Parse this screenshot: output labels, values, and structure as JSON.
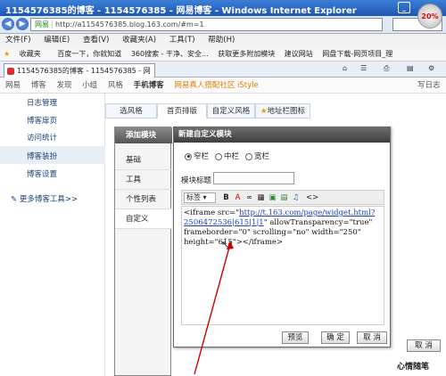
{
  "window": {
    "title": "1154576385的博客 - 1154576385 - 网易博客 - Windows Internet Explorer",
    "badge": "20%"
  },
  "address": {
    "site_tag": "网易",
    "url": "http://a1154576385.blog.163.com/#m=1"
  },
  "menu": [
    "文件(F)",
    "编辑(E)",
    "查看(V)",
    "收藏夹(A)",
    "工具(T)",
    "帮助(H)"
  ],
  "favorites": [
    "收藏夹",
    "百度一下，你就知道",
    "360搜索 - 干净、安全...",
    "获取更多附加模块",
    "建议网站",
    "网盘下载-网页项目_理"
  ],
  "tab": {
    "label": "1154576385的博客 - 1154576385 - 网易博客"
  },
  "site_nav": {
    "items": [
      "网易",
      "博客",
      "发现",
      "小组",
      "风格",
      "手机博客"
    ],
    "promo": "网易真人搭配社区 iStyle",
    "write": "写日志"
  },
  "left_menu": {
    "items": [
      "日志管理",
      "博客扉页",
      "访问统计",
      "博客装扮",
      "博客设置"
    ],
    "more": "更多博客工具>>"
  },
  "sub_tabs": [
    "选风格",
    "首页排版",
    "自定义风格",
    "地址栏图标"
  ],
  "add_panel": {
    "title": "添加模块",
    "items": [
      "基础",
      "工具",
      "个性列表",
      "自定义"
    ]
  },
  "dialog": {
    "title": "新建自定义模块",
    "radios": [
      "窄栏",
      "中栏",
      "宽栏"
    ],
    "selected_radio": "窄栏",
    "title_label": "模块标题",
    "style_select": "标签",
    "toolbar_b": "B",
    "toolbar_a": "A",
    "toolbar_source": "<>",
    "editor": {
      "line1": "<iframe src=\"",
      "link": "http://t.163.com/page/widget.html?2506472536|615|1|1",
      "line2": "\" allowTransparency=\"true\" frameborder=\"0\" scrolling=\"no\" width=\"250\" height=\"615\"></iframe>"
    },
    "buttons": {
      "preview": "预览",
      "ok": "确 定",
      "cancel": "取 消"
    }
  },
  "right": {
    "cancel": "取 消",
    "diary": "心情随笔"
  }
}
